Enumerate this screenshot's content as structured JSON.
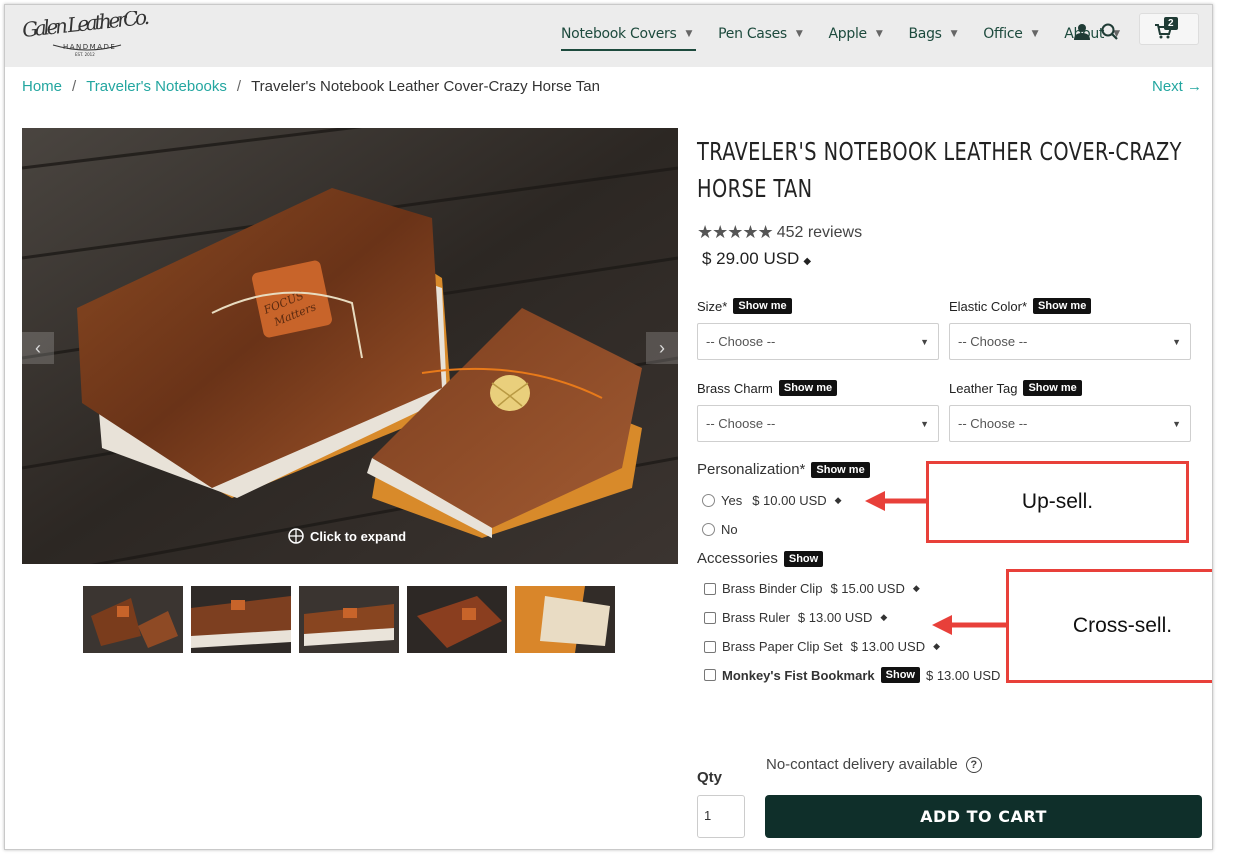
{
  "brand": {
    "logo_text": "GALEN LEATHER CO.",
    "logo_sub": "HANDMADE",
    "logo_est": "EST. 2012"
  },
  "nav": {
    "items": [
      {
        "label": "Notebook Covers",
        "active": true
      },
      {
        "label": "Pen Cases"
      },
      {
        "label": "Apple"
      },
      {
        "label": "Bags"
      },
      {
        "label": "Office"
      },
      {
        "label": "About"
      }
    ],
    "account_icon": "person-icon",
    "search_icon": "search-icon",
    "cart_icon": "cart-icon",
    "cart_count": "2"
  },
  "breadcrumb": {
    "home": "Home",
    "category": "Traveler's Notebooks",
    "current": "Traveler's Notebook Leather Cover-Crazy Horse Tan",
    "next": "Next →"
  },
  "gallery": {
    "expand_label": "Click to expand",
    "prev_icon": "chevron-left-icon",
    "next_icon": "chevron-right-icon"
  },
  "product": {
    "title": "TRAVELER'S NOTEBOOK LEATHER COVER-CRAZY HORSE TAN",
    "stars": "★★★★★",
    "reviews": "452 reviews",
    "price": "$ 29.00 USD"
  },
  "options": {
    "size_label": "Size",
    "elastic_label": "Elastic Color",
    "charm_label": "Brass Charm",
    "tag_label": "Leather Tag",
    "required_mark": "*",
    "show_me": "Show me",
    "choose": "-- Choose --"
  },
  "personalization": {
    "label": "Personalization*",
    "show_me": "Show me",
    "yes_label": "Yes",
    "yes_price": "$ 10.00  USD",
    "no_label": "No"
  },
  "accessories": {
    "label": "Accessories",
    "show": "Show",
    "items": [
      {
        "name": "Brass Binder Clip",
        "price": "$ 15.00  USD"
      },
      {
        "name": "Brass Ruler",
        "price": "$ 13.00  USD"
      },
      {
        "name": "Brass Paper Clip Set",
        "price": "$ 13.00  USD"
      },
      {
        "name": "Monkey's Fist Bookmark",
        "price": "$ 13.00  USD",
        "show": "Show"
      }
    ]
  },
  "annotations": {
    "upsell": "Up-sell.",
    "crosssell": "Cross-sell.",
    "color": "#e8403a"
  },
  "purchase": {
    "delivery": "No-contact delivery available",
    "qty_label": "Qty",
    "qty_value": "1",
    "add_to_cart": "ADD TO CART"
  },
  "colors": {
    "accent": "#23a6a0",
    "nav": "#1d4a3d",
    "button": "#0f2f2a"
  }
}
